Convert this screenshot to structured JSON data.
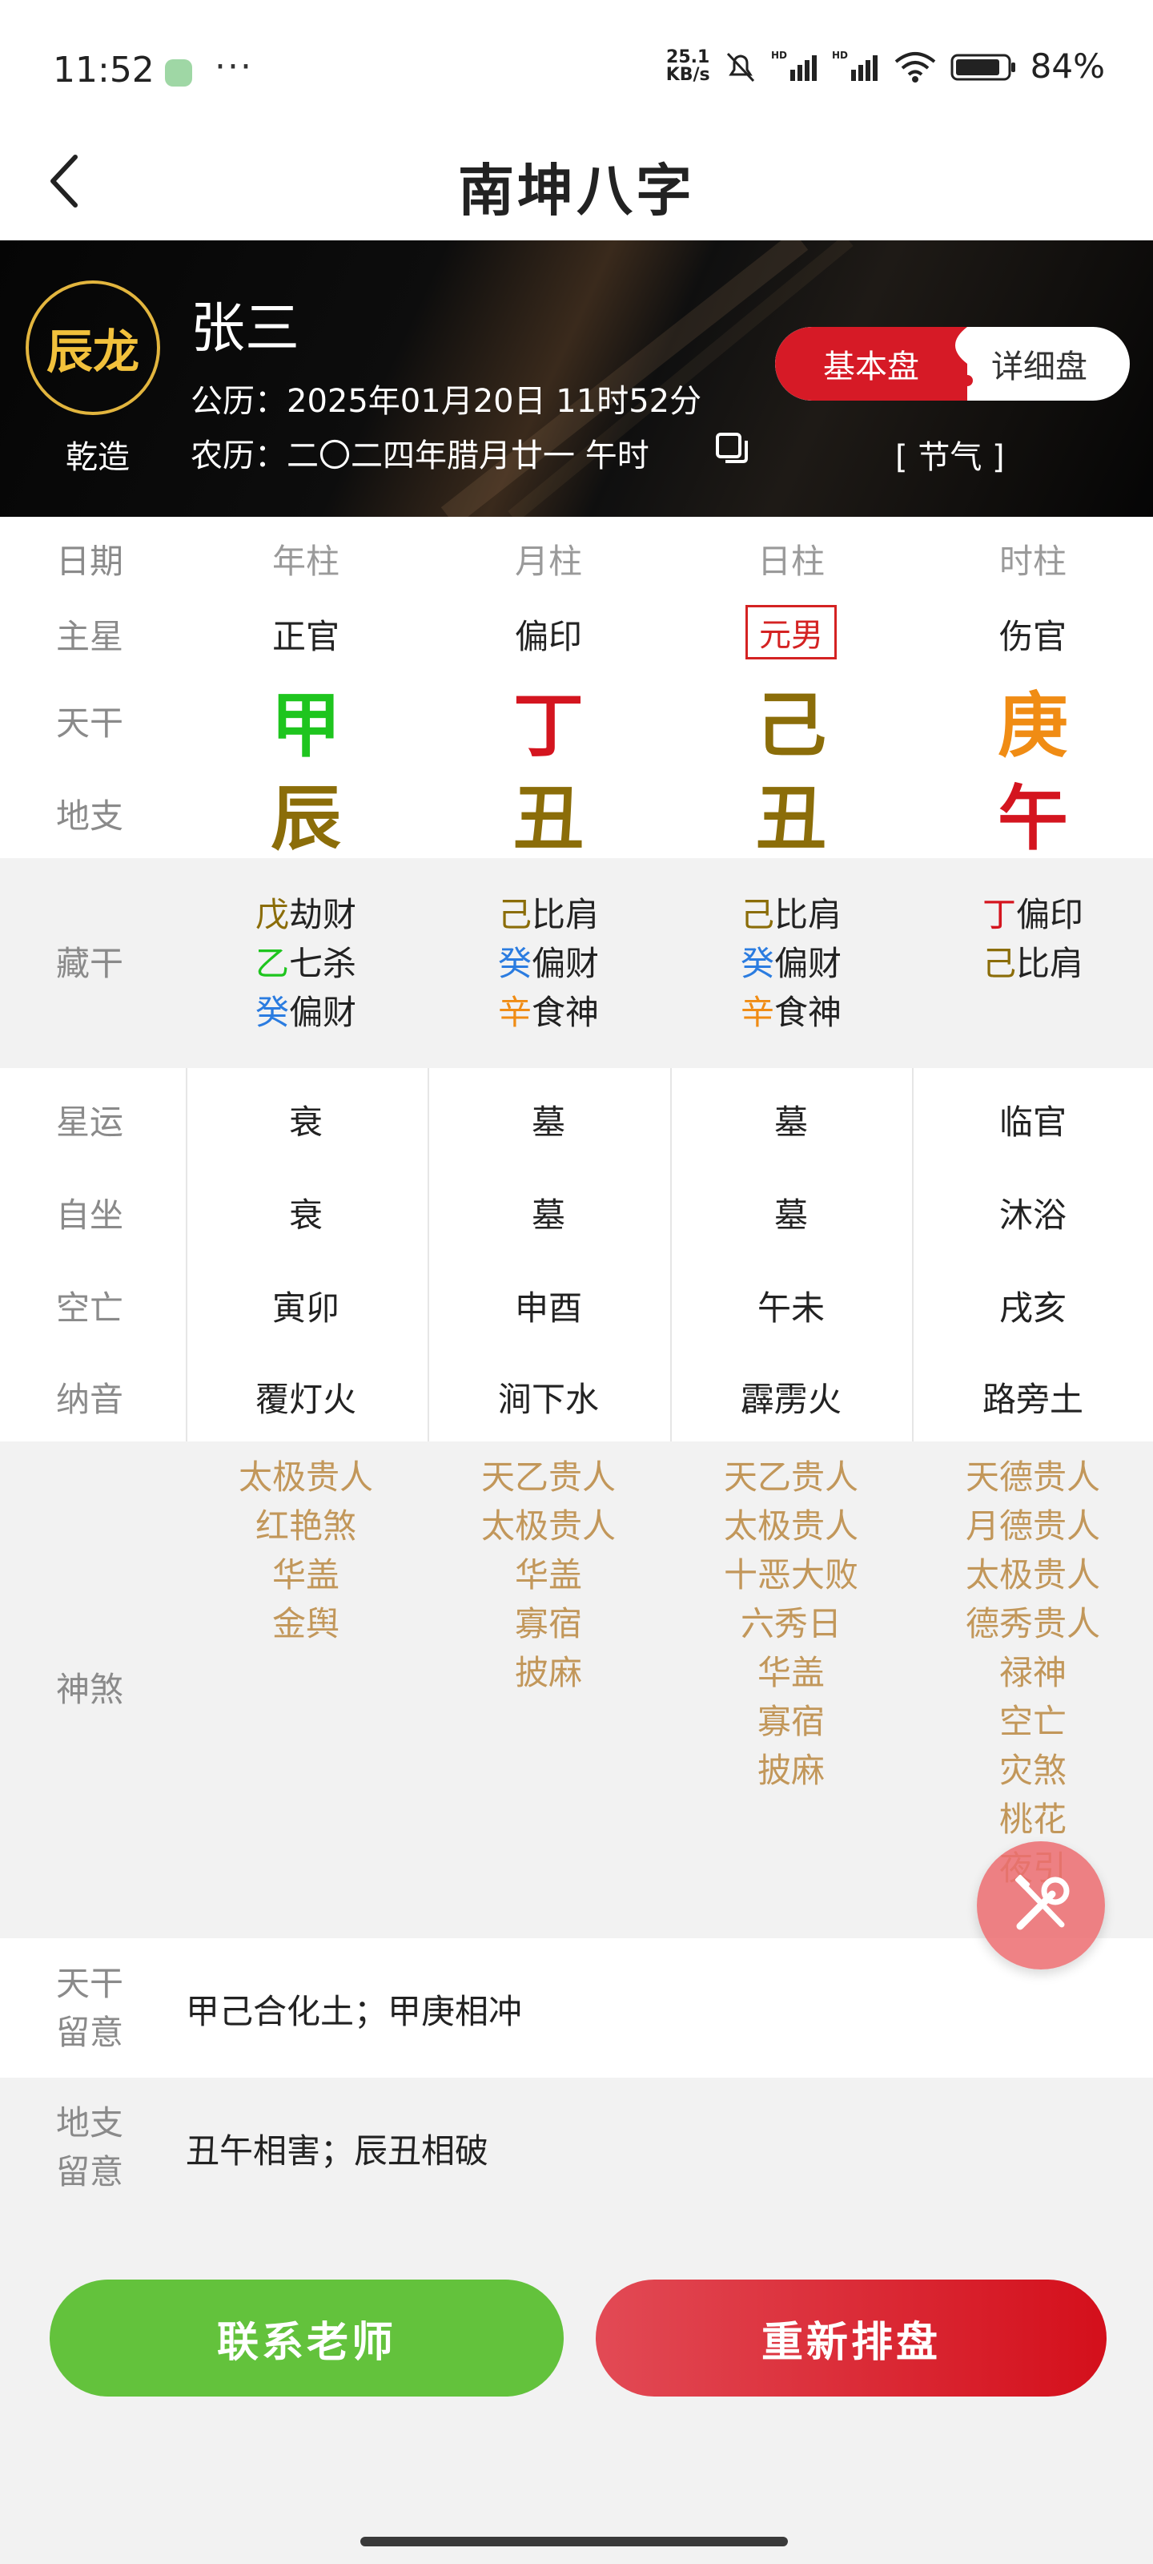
{
  "status_bar": {
    "time": "11:52",
    "speed_top": "25.1",
    "speed_bottom": "KB/s",
    "battery": "84%"
  },
  "header": {
    "title": "南坤八字"
  },
  "profile": {
    "zodiac": "辰龙",
    "gender_label": "乾造",
    "name": "张三",
    "solar": "公历：2025年01月20日 11时52分",
    "lunar": "农历：二〇二四年腊月廿一 午时",
    "toggle_left": "基本盘",
    "toggle_right": "详细盘",
    "jieqi": "[ 节气 ]"
  },
  "grid": {
    "labels": {
      "date": "日期",
      "main_star": "主星",
      "stem": "天干",
      "branch": "地支",
      "hidden": "藏干",
      "star_luck": "星运",
      "self_sit": "自坐",
      "void": "空亡",
      "nayin": "纳音",
      "shensha": "神煞"
    },
    "columns": [
      {
        "header": "年柱",
        "main_star": "正官",
        "stem": "甲",
        "stem_color": "#1ec51e",
        "branch": "辰",
        "branch_color": "#8b6d09",
        "hidden": [
          {
            "char": "戊",
            "color": "#8b6d09",
            "text": "劫财"
          },
          {
            "char": "乙",
            "color": "#1ec51e",
            "text": "七杀"
          },
          {
            "char": "癸",
            "color": "#2b7ce0",
            "text": "偏财"
          }
        ],
        "star_luck": "衰",
        "self_sit": "衰",
        "void": "寅卯",
        "nayin": "覆灯火",
        "shensha": [
          "太极贵人",
          "红艳煞",
          "华盖",
          "金舆"
        ]
      },
      {
        "header": "月柱",
        "main_star": "偏印",
        "stem": "丁",
        "stem_color": "#d4151f",
        "branch": "丑",
        "branch_color": "#8b6d09",
        "hidden": [
          {
            "char": "己",
            "color": "#8b6d09",
            "text": "比肩"
          },
          {
            "char": "癸",
            "color": "#2b7ce0",
            "text": "偏财"
          },
          {
            "char": "辛",
            "color": "#f08c14",
            "text": "食神"
          }
        ],
        "star_luck": "墓",
        "self_sit": "墓",
        "void": "申酉",
        "nayin": "涧下水",
        "shensha": [
          "天乙贵人",
          "太极贵人",
          "华盖",
          "寡宿",
          "披麻"
        ]
      },
      {
        "header": "日柱",
        "main_star": "元男",
        "stem": "己",
        "stem_color": "#8b6d09",
        "branch": "丑",
        "branch_color": "#8b6d09",
        "hidden": [
          {
            "char": "己",
            "color": "#8b6d09",
            "text": "比肩"
          },
          {
            "char": "癸",
            "color": "#2b7ce0",
            "text": "偏财"
          },
          {
            "char": "辛",
            "color": "#f08c14",
            "text": "食神"
          }
        ],
        "star_luck": "墓",
        "self_sit": "墓",
        "void": "午未",
        "nayin": "霹雳火",
        "shensha": [
          "天乙贵人",
          "太极贵人",
          "十恶大败",
          "六秀日",
          "华盖",
          "寡宿",
          "披麻"
        ]
      },
      {
        "header": "时柱",
        "main_star": "伤官",
        "stem": "庚",
        "stem_color": "#f08c14",
        "branch": "午",
        "branch_color": "#d4151f",
        "hidden": [
          {
            "char": "丁",
            "color": "#d4151f",
            "text": "偏印"
          },
          {
            "char": "己",
            "color": "#8b6d09",
            "text": "比肩"
          }
        ],
        "star_luck": "临官",
        "self_sit": "沐浴",
        "void": "戌亥",
        "nayin": "路旁土",
        "shensha": [
          "天德贵人",
          "月德贵人",
          "太极贵人",
          "德秀贵人",
          "禄神",
          "空亡",
          "灾煞",
          "桃花",
          "夜引"
        ]
      }
    ]
  },
  "notes": {
    "stem_label_1": "天干",
    "stem_label_2": "留意",
    "stem_text": "甲己合化土；甲庚相冲",
    "branch_label_1": "地支",
    "branch_label_2": "留意",
    "branch_text": "丑午相害；辰丑相破"
  },
  "buttons": {
    "contact": "联系老师",
    "rearrange": "重新排盘"
  },
  "colors": {
    "accent_red": "#d61a26",
    "accent_green": "#63c23c",
    "gold": "#e2b53e",
    "shensha": "#c2975a"
  },
  "icons": {
    "back": "back-arrow-icon",
    "copy": "copy-icon",
    "fab": "tools-icon"
  }
}
